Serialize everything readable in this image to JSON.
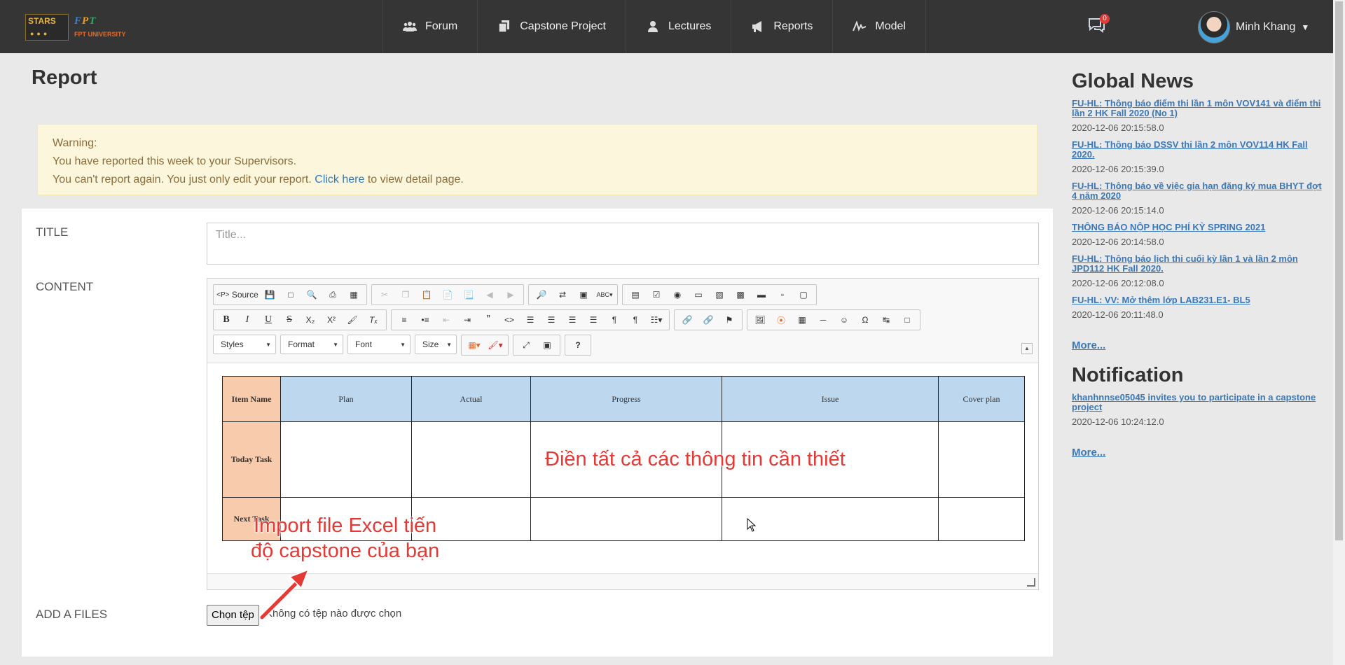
{
  "nav": {
    "logo_stars": "STARS",
    "logo_fpt": "FPT",
    "logo_university": "FPT UNIVERSITY",
    "items": [
      {
        "label": "Forum",
        "icon": "users-icon"
      },
      {
        "label": "Capstone Project",
        "icon": "copy-icon"
      },
      {
        "label": "Lectures",
        "icon": "user-icon"
      },
      {
        "label": "Reports",
        "icon": "megaphone-icon"
      },
      {
        "label": "Model",
        "icon": "signature-icon"
      }
    ],
    "chat_badge": "0",
    "user_name": "Minh Khang"
  },
  "page": {
    "title": "Report",
    "warning": {
      "line1": "Warning:",
      "line2": "You have reported this week to your Supervisors.",
      "line3_pre": "You can't report again. You just only edit your report. ",
      "line3_link": "Click here",
      "line3_post": " to view detail page."
    }
  },
  "form": {
    "title_label": "TITLE",
    "title_placeholder": "Title...",
    "content_label": "CONTENT",
    "files_label": "ADD A FILES",
    "file_button": "Chọn tệp",
    "file_status": "Không có tệp nào được chọn"
  },
  "editor": {
    "source_label": "Source",
    "styles": "Styles",
    "format": "Format",
    "font": "Font",
    "size": "Size",
    "table": {
      "headers": [
        "Item Name",
        "Plan",
        "Actual",
        "Progress",
        "Issue",
        "Cover plan"
      ],
      "rows": [
        "Today Task",
        "Next Task"
      ]
    }
  },
  "annotations": {
    "fill_all": "Điền tất cả các thông tin cần thiết",
    "import_line1": "Import file Excel tiến",
    "import_line2": "độ capstone của bạn"
  },
  "sidebar": {
    "global_news_title": "Global News",
    "news": [
      {
        "title": "FU-HL: Thông báo điểm thi lần 1 môn VOV141 và điểm thi lần 2 HK Fall 2020 (No 1)",
        "date": "2020-12-06 20:15:58.0"
      },
      {
        "title": "FU-HL: Thông báo DSSV thi lần 2 môn VOV114 HK Fall 2020.",
        "date": "2020-12-06 20:15:39.0"
      },
      {
        "title": "FU-HL: Thông báo về việc gia hạn đăng ký mua BHYT đợt 4 năm 2020",
        "date": "2020-12-06 20:15:14.0"
      },
      {
        "title": "THÔNG BÁO NỘP HỌC PHÍ KỲ SPRING 2021",
        "date": "2020-12-06 20:14:58.0"
      },
      {
        "title": "FU-HL: Thông báo lịch thi cuối kỳ lần 1 và lần 2 môn JPD112 HK Fall 2020.",
        "date": "2020-12-06 20:12:08.0"
      },
      {
        "title": "FU-HL: VV: Mở thêm lớp LAB231.E1- BL5",
        "date": "2020-12-06 20:11:48.0"
      }
    ],
    "news_more": "More...",
    "notification_title": "Notification",
    "notifications": [
      {
        "title": "khanhnnse05045 invites you to participate in a capstone project",
        "date": "2020-12-06 10:24:12.0"
      }
    ],
    "notification_more": "More..."
  }
}
